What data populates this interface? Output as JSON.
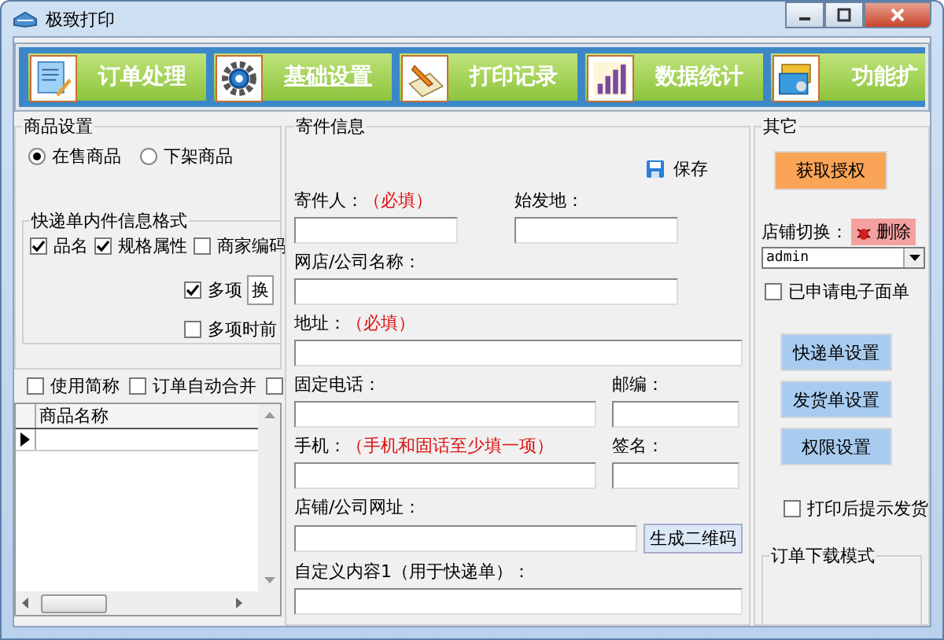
{
  "window": {
    "title": "极致打印"
  },
  "toolbar": [
    {
      "label": "订单处理",
      "selected": false
    },
    {
      "label": "基础设置",
      "selected": true
    },
    {
      "label": "打印记录",
      "selected": false
    },
    {
      "label": "数据统计",
      "selected": false
    },
    {
      "label": "功能扩",
      "selected": false
    }
  ],
  "product_settings": {
    "title": "商品设置",
    "radios": [
      {
        "label": "在售商品",
        "selected": true
      },
      {
        "label": "下架商品",
        "selected": false
      }
    ],
    "format_group": {
      "title": "快递单内件信息格式",
      "checkboxes": [
        {
          "label": "品名",
          "checked": true
        },
        {
          "label": "规格属性",
          "checked": true
        },
        {
          "label": "商家编码",
          "checked": false
        }
      ],
      "multi_item": {
        "label": "多项",
        "checked": true,
        "value": "换"
      },
      "multi_prefix": {
        "label": "多项时前",
        "checked": false
      }
    }
  },
  "options": [
    {
      "label": "使用简称",
      "checked": false
    },
    {
      "label": "订单自动合并",
      "checked": false
    },
    {
      "checked": false
    }
  ],
  "grid": {
    "columns": [
      "商品名称"
    ]
  },
  "sender": {
    "title": "寄件信息",
    "save": "保存",
    "rows": [
      [
        {
          "label": "寄件人：",
          "note": "（必填）"
        },
        {
          "label": "始发地："
        }
      ],
      [
        {
          "label": "网店/公司名称："
        }
      ],
      [
        {
          "label": "地址：",
          "note": "（必填）"
        }
      ],
      [
        {
          "label": "固定电话："
        },
        {
          "label": "邮编："
        }
      ],
      [
        {
          "label": "手机：",
          "note": "（手机和固话至少填一项）"
        },
        {
          "label": "签名："
        }
      ],
      [
        {
          "label": "店铺/公司网址：",
          "button": "生成二维码"
        }
      ],
      [
        {
          "label": "自定义内容1（用于快递单）："
        }
      ]
    ]
  },
  "other": {
    "title": "其它",
    "auth_button": "获取授权",
    "store_label": "店铺切换：",
    "delete_button": "删除",
    "store_select": "admin",
    "e_waybill": {
      "label": "已申请电子面单",
      "checked": false
    },
    "buttons": [
      "快递单设置",
      "发货单设置",
      "权限设置"
    ],
    "print_prompt": {
      "label": "打印后提示发货",
      "checked": false
    },
    "download_mode": {
      "title": "订单下载模式"
    }
  }
}
